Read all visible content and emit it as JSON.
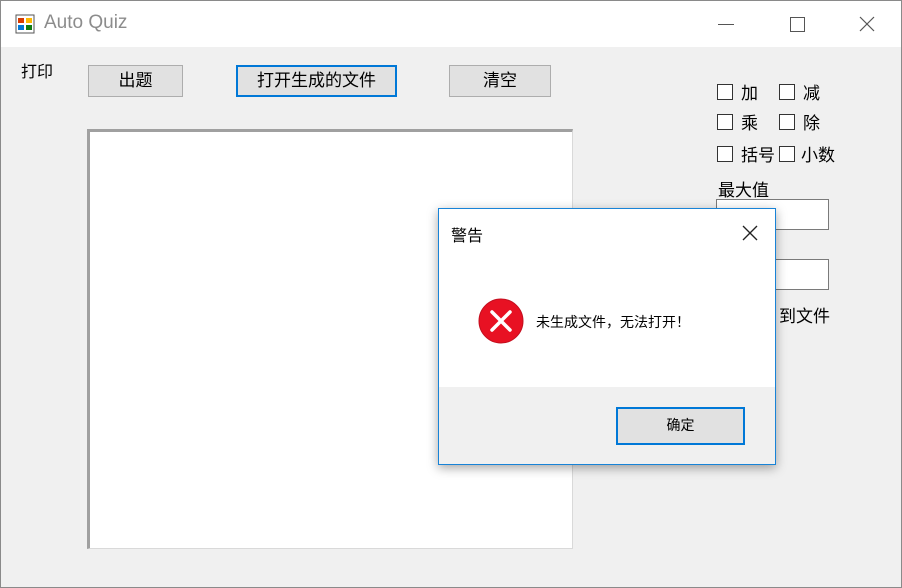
{
  "window": {
    "title": "Auto Quiz",
    "icons": {
      "app": "app-icon",
      "minimize": "minimize-icon",
      "maximize": "maximize-icon",
      "close": "close-icon"
    }
  },
  "menu": {
    "print": "打印"
  },
  "toolbar": {
    "generate_label": "出题",
    "open_file_label": "打开生成的文件",
    "clear_label": "清空"
  },
  "options": {
    "add": "加",
    "subtract": "减",
    "multiply": "乘",
    "divide": "除",
    "parentheses": "括号",
    "decimal": "小数"
  },
  "settings": {
    "max_value_label": "最大值",
    "max_value": "",
    "count_value": "",
    "save_to_file_fragment": "到文件"
  },
  "dialog": {
    "title": "警告",
    "message": "未生成文件，无法打开！",
    "ok_label": "确定",
    "icon": "error-icon"
  },
  "colors": {
    "focus_border": "#0078d7",
    "error_red": "#e81123",
    "window_bg": "#f0f0f0"
  }
}
